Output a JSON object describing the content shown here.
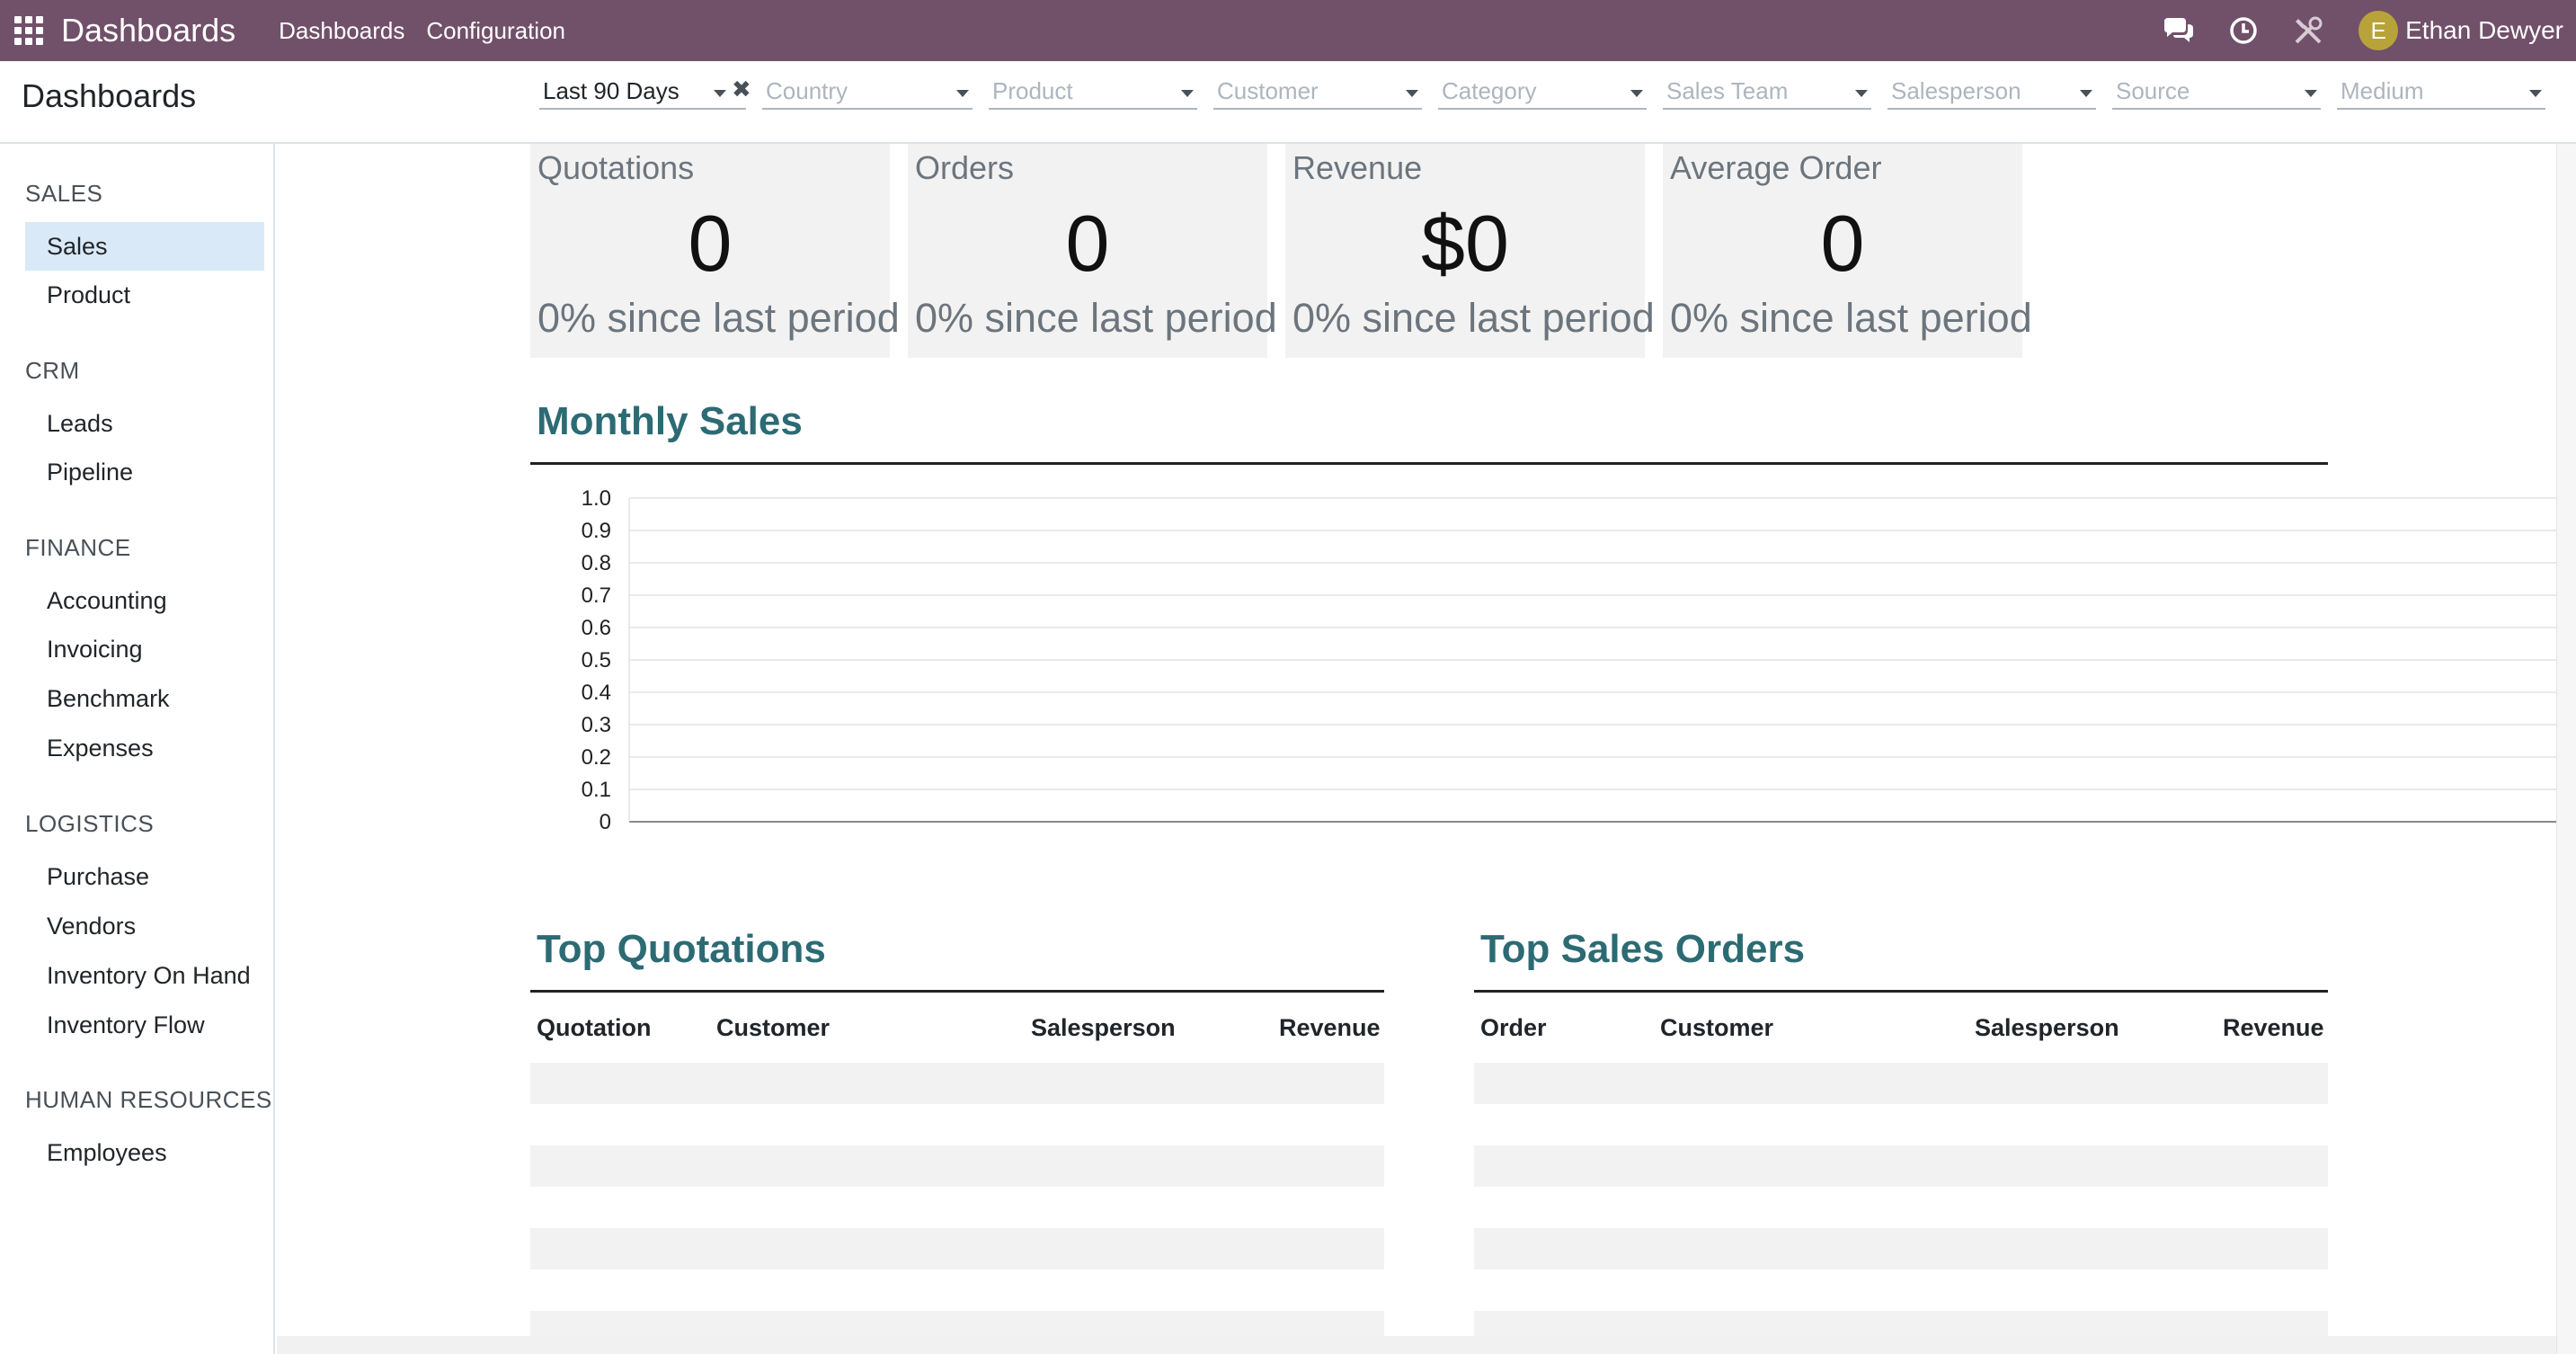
{
  "navbar": {
    "brand": "Dashboards",
    "links": [
      "Dashboards",
      "Configuration"
    ],
    "user": {
      "initial": "E",
      "name": "Ethan Dewyer"
    },
    "icons": [
      "apps-grid-icon",
      "chat-icon",
      "clock-icon",
      "tools-icon"
    ]
  },
  "control_panel": {
    "title": "Dashboards",
    "filters": [
      {
        "label": "Last 90 Days",
        "active": true
      },
      {
        "label": "Country",
        "active": false
      },
      {
        "label": "Product",
        "active": false
      },
      {
        "label": "Customer",
        "active": false
      },
      {
        "label": "Category",
        "active": false
      },
      {
        "label": "Sales Team",
        "active": false
      },
      {
        "label": "Salesperson",
        "active": false
      },
      {
        "label": "Source",
        "active": false
      },
      {
        "label": "Medium",
        "active": false
      }
    ],
    "clear_symbol": "✖"
  },
  "sidebar": {
    "sections": [
      {
        "title": "SALES",
        "items": [
          "Sales",
          "Product"
        ]
      },
      {
        "title": "CRM",
        "items": [
          "Leads",
          "Pipeline"
        ]
      },
      {
        "title": "FINANCE",
        "items": [
          "Accounting",
          "Invoicing",
          "Benchmark",
          "Expenses"
        ]
      },
      {
        "title": "LOGISTICS",
        "items": [
          "Purchase",
          "Vendors",
          "Inventory On Hand",
          "Inventory Flow"
        ]
      },
      {
        "title": "HUMAN RESOURCES",
        "items": [
          "Employees"
        ]
      }
    ],
    "selected": "Sales"
  },
  "kpis": [
    {
      "title": "Quotations",
      "value": "0",
      "sub": "0% since last period"
    },
    {
      "title": "Orders",
      "value": "0",
      "sub": "0% since last period"
    },
    {
      "title": "Revenue",
      "value": "$0",
      "sub": "0% since last period"
    },
    {
      "title": "Average Order",
      "value": "0",
      "sub": "0% since last period"
    }
  ],
  "monthly_sales": {
    "title": "Monthly Sales"
  },
  "chart_data": {
    "type": "line",
    "title": "Monthly Sales",
    "xlabel": "",
    "ylabel": "",
    "ylim": [
      0,
      1.0
    ],
    "yticks": [
      "1.0",
      "0.9",
      "0.8",
      "0.7",
      "0.6",
      "0.5",
      "0.4",
      "0.3",
      "0.2",
      "0.1",
      "0"
    ],
    "grid": true,
    "series": []
  },
  "top_quotations": {
    "title": "Top Quotations",
    "columns": [
      "Quotation",
      "Customer",
      "Salesperson",
      "Revenue"
    ],
    "rows": []
  },
  "top_sales_orders": {
    "title": "Top Sales Orders",
    "columns": [
      "Order",
      "Customer",
      "Salesperson",
      "Revenue"
    ],
    "rows": []
  }
}
